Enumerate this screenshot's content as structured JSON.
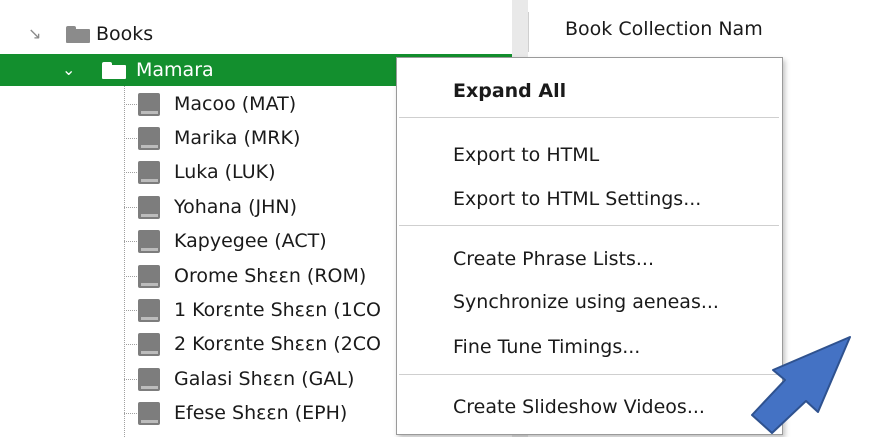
{
  "tree": {
    "root": {
      "label": "Books",
      "expander": "expanded-arrow",
      "icon": "folder-icon"
    },
    "selected_node": {
      "label": "Mamara",
      "expander": "chevron-down",
      "icon": "folder-icon"
    },
    "books": [
      "Macoo (MAT)",
      "Marika (MRK)",
      "Luka (LUK)",
      "Yohana (JHN)",
      "Kapyegee (ACT)",
      "Orome Shεεn (ROM)",
      "1 Korεnte Shεεn (1CO",
      "2 Korεnte Shεεn (2CO",
      "Galasi Shεεn (GAL)",
      "Efese Shεεn (EPH)"
    ]
  },
  "right_pane": {
    "header": "Book Collection Nam"
  },
  "context_menu": {
    "items": [
      {
        "label": "Expand All",
        "bold": true
      },
      {
        "label": "Export to HTML"
      },
      {
        "label": "Export to HTML Settings..."
      },
      {
        "label": "Create Phrase Lists..."
      },
      {
        "label": "Synchronize using aeneas..."
      },
      {
        "label": "Fine Tune Timings..."
      },
      {
        "label": "Create Slideshow Videos..."
      }
    ]
  },
  "colors": {
    "selection": "#138f2e",
    "arrow_fill": "#4472c4",
    "arrow_stroke": "#2f528f"
  },
  "icons": {
    "book": "book-icon",
    "annotation_arrow": "arrow-icon"
  }
}
